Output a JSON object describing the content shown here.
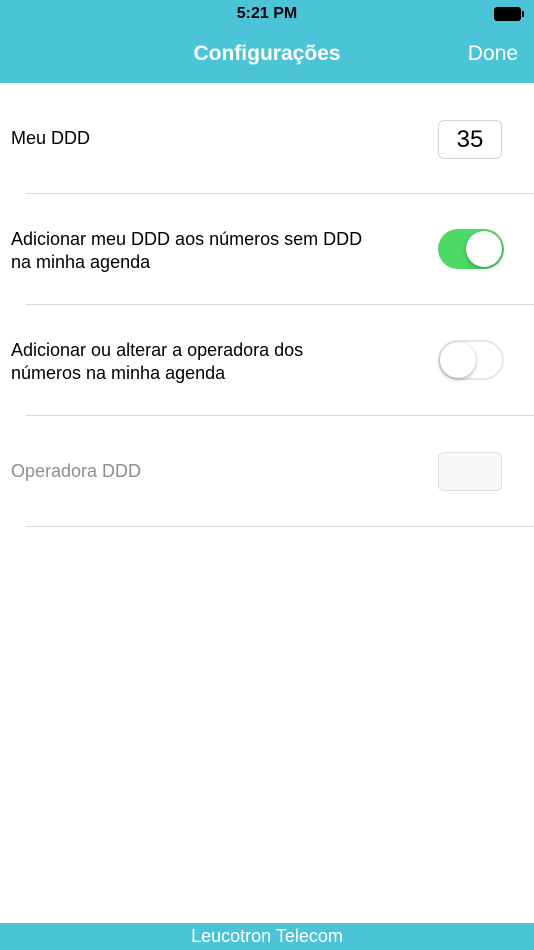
{
  "status_bar": {
    "time": "5:21 PM",
    "battery_icon": "battery-full-icon"
  },
  "nav": {
    "title": "Configurações",
    "done_label": "Done"
  },
  "settings": {
    "meu_ddd": {
      "label": "Meu DDD",
      "value": "35"
    },
    "add_ddd": {
      "label_line1": "Adicionar meu DDD aos números sem DDD",
      "label_line2": "na minha agenda",
      "enabled": true
    },
    "operadora": {
      "label_line1": "Adicionar ou alterar a operadora dos",
      "label_line2": "números na minha agenda",
      "enabled": false
    },
    "operadora_ddd": {
      "label": "Operadora DDD",
      "value": ""
    }
  },
  "footer": {
    "text": "Leucotron Telecom"
  },
  "colors": {
    "accent": "#4bc4d8",
    "toggle_on": "#4cd964"
  }
}
